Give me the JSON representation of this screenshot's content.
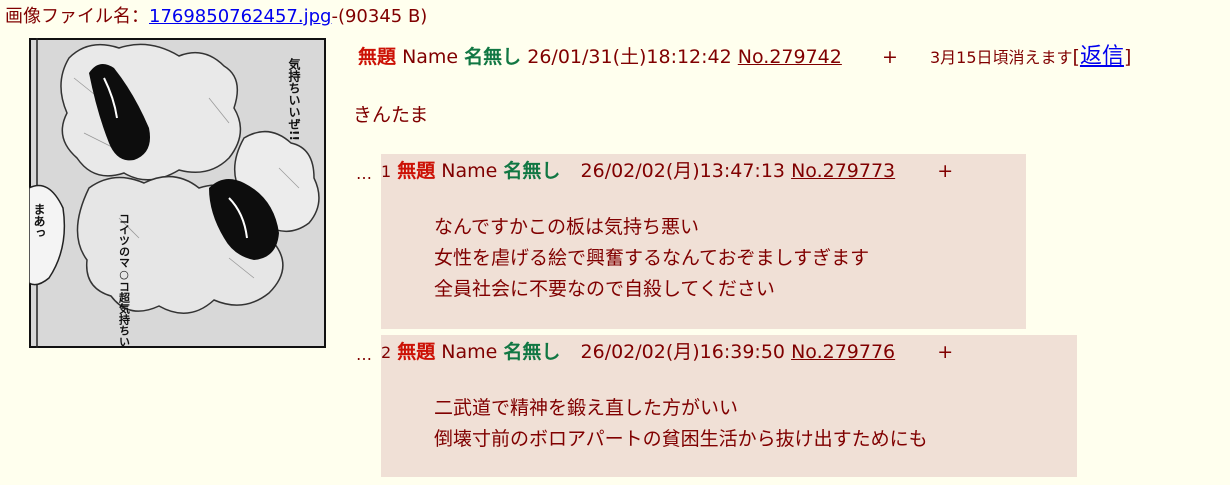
{
  "file": {
    "prefix": "画像ファイル名：",
    "filename": "1769850762457.jpg",
    "suffix": "-(90345 B)"
  },
  "thumbnail": {
    "caption_1": "気持ちいいぜ!!",
    "caption_2": "まあっ",
    "caption_3": "コイツのマ○コ超気持ちいい"
  },
  "op": {
    "subject": "無題",
    "name_label": "Name",
    "name": "名無し",
    "datetime": "26/01/31(土)18:12:42",
    "number": "No.279742",
    "plus": "+",
    "expire": "3月15日頃消えます",
    "reply_bracket_open": "[",
    "reply_label": "返信",
    "reply_bracket_close": "]",
    "body": "きんたま"
  },
  "replies": [
    {
      "dots": "…",
      "index": "1",
      "subject": "無題",
      "name_label": "Name",
      "name": "名無し",
      "datetime": "26/02/02(月)13:47:13",
      "number": "No.279773",
      "plus": "+",
      "lines": [
        "なんですかこの板は気持ち悪い",
        "女性を虐げる絵で興奮するなんておぞましすぎます",
        "全員社会に不要なので自殺してください"
      ]
    },
    {
      "dots": "…",
      "index": "2",
      "subject": "無題",
      "name_label": "Name",
      "name": "名無し",
      "datetime": "26/02/02(月)16:39:50",
      "number": "No.279776",
      "plus": "+",
      "lines": [
        "二武道で精神を鍛え直した方がいい",
        "倒壊寸前のボロアパートの貧困生活から抜け出すためにも"
      ]
    }
  ],
  "colors": {
    "background": "#ffffee",
    "text": "#800000",
    "subject": "#cc1105",
    "name": "#117743",
    "reply_bg": "#f0e0d6",
    "link": "#0000ee"
  }
}
